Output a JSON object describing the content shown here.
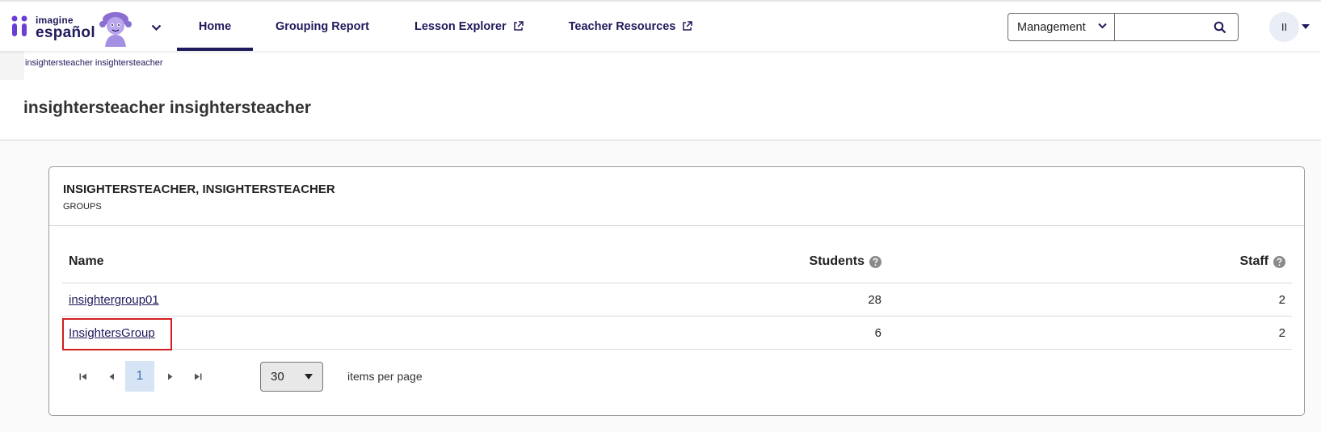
{
  "header": {
    "logo_small": "imagine",
    "logo_big": "español",
    "nav": [
      {
        "label": "Home",
        "active": true
      },
      {
        "label": "Grouping Report"
      },
      {
        "label": "Lesson Explorer",
        "icon": "external-link-icon"
      },
      {
        "label": "Teacher Resources",
        "icon": "external-link-icon"
      }
    ],
    "management_select": "Management",
    "search_placeholder": "",
    "avatar_initials": "II"
  },
  "breadcrumb": "insightersteacher insightersteacher",
  "page_title": "insightersteacher insightersteacher",
  "card": {
    "title": "INSIGHTERSTEACHER, INSIGHTERSTEACHER",
    "subtitle": "GROUPS",
    "columns": [
      "Name",
      "Students",
      "Staff"
    ],
    "rows": [
      {
        "name": "insightergroup01",
        "students": "28",
        "staff": "2"
      },
      {
        "name": "InsightersGroup",
        "students": "6",
        "staff": "2"
      }
    ],
    "pager": {
      "current_page": "1",
      "per_page": "30",
      "per_page_label": "items per page"
    }
  },
  "colors": {
    "brand_navy": "#1f1a5b",
    "brand_purple": "#6b3fd6",
    "highlight_red": "#d41e1e",
    "pager_active_bg": "#d6e4f5"
  }
}
